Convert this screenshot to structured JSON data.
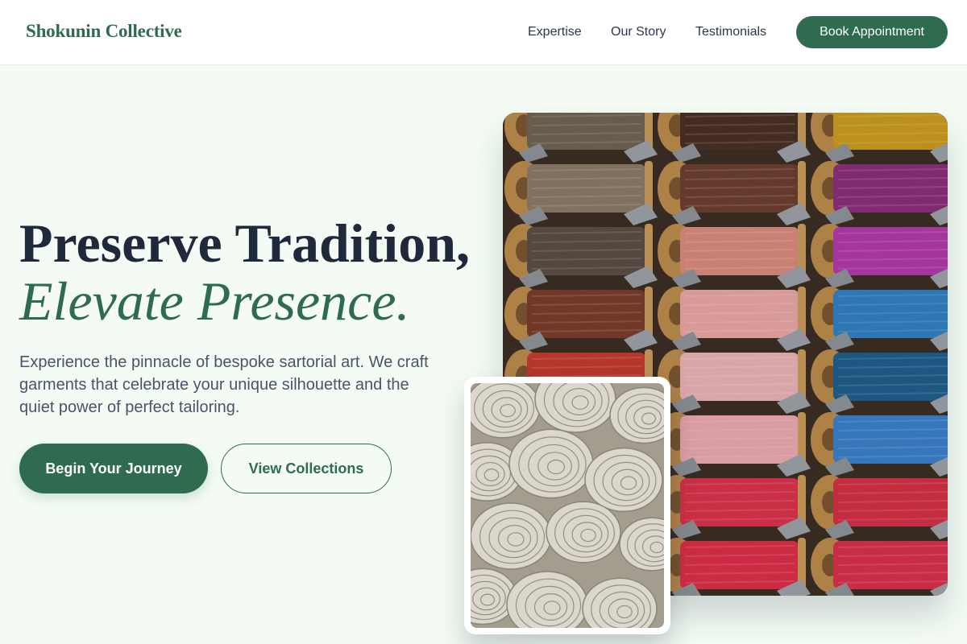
{
  "brand": {
    "name": "Shokunin Collective",
    "accent_color": "#2e6b4f",
    "background_color": "#f3fbf4"
  },
  "nav": {
    "links": [
      "Expertise",
      "Our Story",
      "Testimonials"
    ],
    "cta_label": "Book Appointment"
  },
  "hero": {
    "headline_line1": "Preserve Tradition,",
    "headline_line2": "Elevate Presence.",
    "description": "Experience the pinnacle of bespoke sartorial art. We craft garments that celebrate your unique silhouette and the quiet power of perfect tailoring.",
    "primary_cta": "Begin Your Journey",
    "secondary_cta": "View Collections"
  },
  "images": {
    "main": "thread-spools-photo",
    "secondary": "fabric-rolls-photo"
  }
}
